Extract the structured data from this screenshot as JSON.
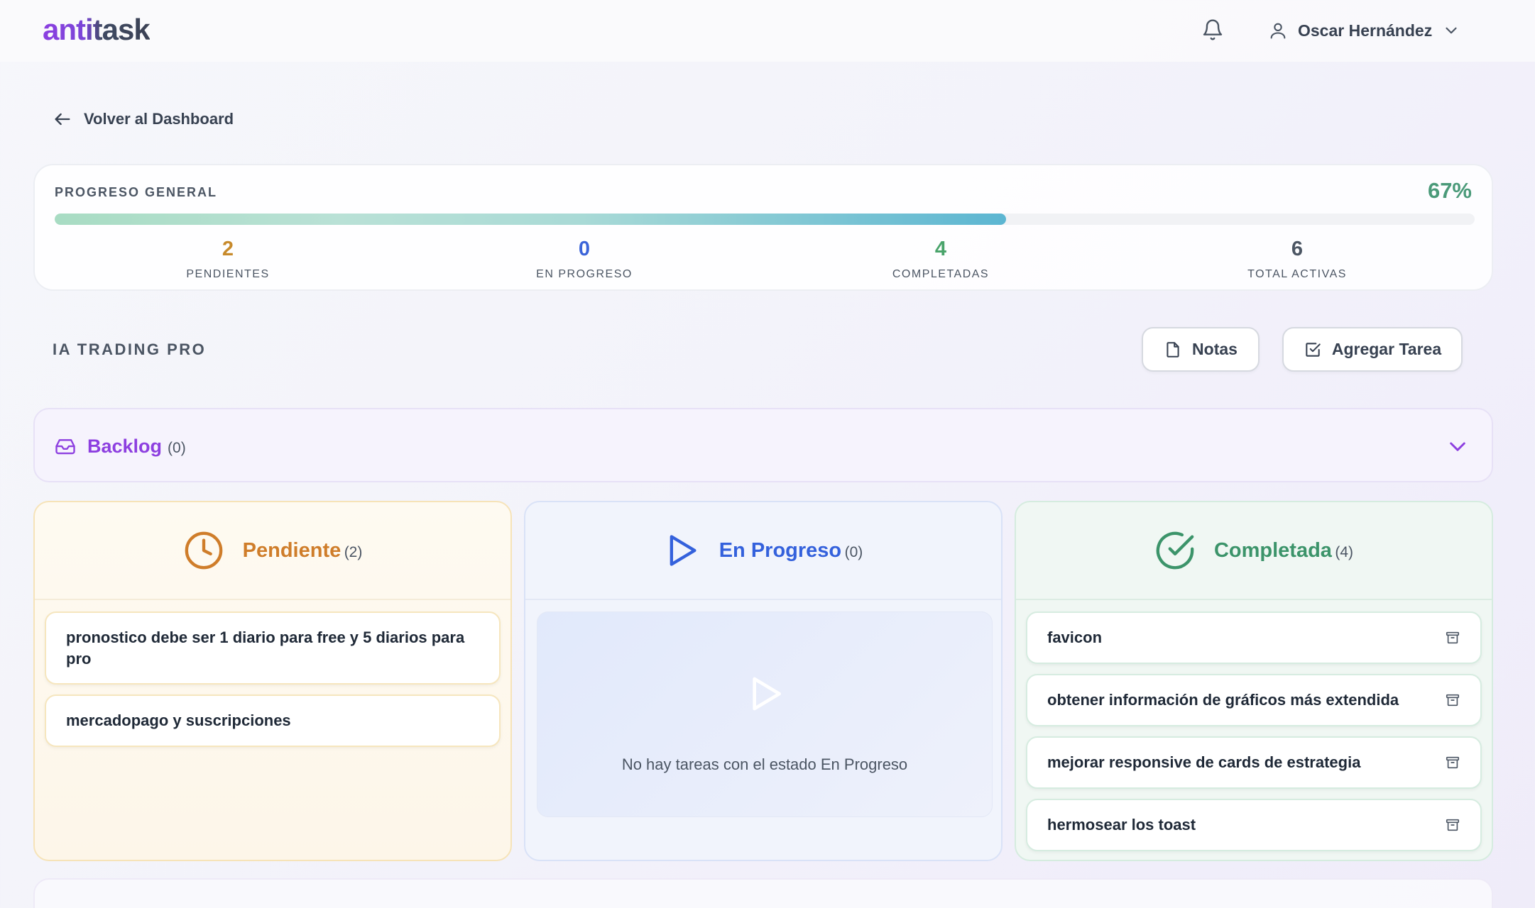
{
  "app": {
    "logo": "antitask"
  },
  "header": {
    "user_name": "Oscar Hernández"
  },
  "nav": {
    "back_label": "Volver al Dashboard"
  },
  "progress": {
    "title": "PROGRESO GENERAL",
    "percent_label": "67%",
    "percent": 0.67,
    "stats": [
      {
        "value": "2",
        "label": "PENDIENTES",
        "color": "#c78a2b"
      },
      {
        "value": "0",
        "label": "EN PROGRESO",
        "color": "#3b64d9"
      },
      {
        "value": "4",
        "label": "COMPLETADAS",
        "color": "#4aa46b"
      },
      {
        "value": "6",
        "label": "TOTAL ACTIVAS",
        "color": "#4b5563"
      }
    ]
  },
  "project": {
    "title": "IA TRADING PRO",
    "notes_label": "Notas",
    "add_task_label": "Agregar Tarea"
  },
  "backlog": {
    "label": "Backlog",
    "count": "(0)"
  },
  "columns": {
    "pending": {
      "title": "Pendiente",
      "count": "(2)",
      "color": "#cf7d2a",
      "tasks": [
        "pronostico debe ser 1 diario para free y 5 diarios para pro",
        "mercadopago y suscripciones"
      ]
    },
    "in_progress": {
      "title": "En Progreso",
      "count": "(0)",
      "color": "#3461dc",
      "empty_text": "No hay tareas con el estado En Progreso"
    },
    "completed": {
      "title": "Completada",
      "count": "(4)",
      "color": "#3c946a",
      "tasks": [
        "favicon",
        "obtener información de gráficos más extendida",
        "mejorar responsive de cards de estrategia",
        "hermosear los toast"
      ]
    }
  },
  "icons": {
    "bell": "bell-icon",
    "user": "user-icon",
    "chevron": "chevron-down-icon",
    "back": "arrow-left-icon",
    "notes": "file-icon",
    "add": "checkbox-icon",
    "backlog": "inbox-icon",
    "pending": "clock-icon",
    "in_progress": "play-icon",
    "completed": "check-circle-icon",
    "archive": "archive-icon"
  }
}
